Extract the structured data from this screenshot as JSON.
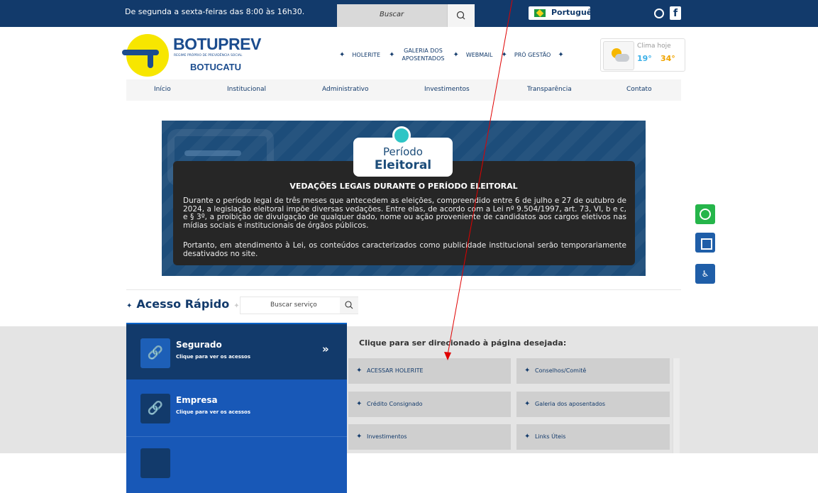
{
  "topbar": {
    "hours": "De segunda a sexta-feiras das 8:00 às 16h30.",
    "search_placeholder": "Buscar",
    "language": "Português"
  },
  "logo": {
    "title": "BOTUPREV",
    "subtitle": "REGIME PRÓPRIO DE PREVIDÊNCIA SOCIAL",
    "city": "BOTUCATU"
  },
  "quicknav": {
    "holerite": "HOLERITE",
    "galeria_line1": "GALERIA DOS",
    "galeria_line2": "APOSENTADOS",
    "webmail": "WEBMAIL",
    "pro_gestao": "PRÓ GESTÃO"
  },
  "weather": {
    "label": "Clima hoje",
    "min": "19°",
    "max": "34°"
  },
  "mainnav": [
    "Início",
    "Institucional",
    "Administrativo",
    "Investimentos",
    "Transparência",
    "Contato"
  ],
  "banner": {
    "line1": "Período",
    "line2": "Eleitoral",
    "heading": "VEDAÇÕES LEGAIS DURANTE O PERÍODO ELEITORAL",
    "para1": "Durante o período legal de três meses que antecedem as eleições, compreendido entre 6 de julho e 27 de outubro de 2024, a legislação eleitoral impõe diversas vedações. Entre elas, de acordo com a Lei nº 9.504/1997, art. 73, VI, b e c, e § 3º, a proibição de divulgação de qualquer dado, nome ou ação proveniente de candidatos aos cargos eletivos nas mídias sociais e institucionais de órgãos públicos.",
    "para2": "Portanto, em atendimento à Lei, os conteúdos caracterizados como publicidade institucional serão temporariamente desativados no site."
  },
  "acesso": {
    "title": "Acesso Rápido",
    "search_placeholder": "Buscar serviço",
    "prompt": "Clique para ser direcionado à página desejada:",
    "categories": [
      {
        "title": "Segurado",
        "subtitle": "Clique para ver os acessos"
      },
      {
        "title": "Empresa",
        "subtitle": "Clique para ver os acessos"
      },
      {
        "title": "",
        "subtitle": ""
      }
    ],
    "tiles": [
      "ACESSAR HOLERITE",
      "Conselhos/Comitê",
      "Crédito Consignado",
      "Galeria dos aposentados",
      "Investimentos",
      "Links Úteis"
    ]
  },
  "colors": {
    "navy": "#123a6b",
    "blue": "#1858b7",
    "annotation_arrow": "#e00000"
  }
}
